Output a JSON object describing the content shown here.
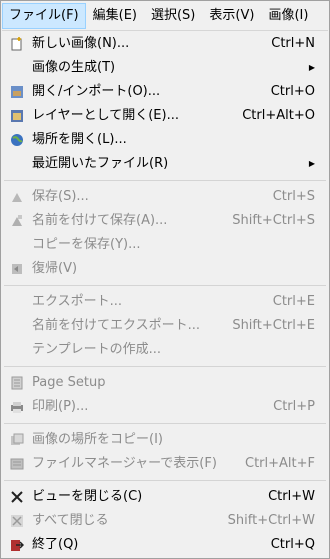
{
  "menubar": {
    "items": [
      {
        "label": "ファイル(F)"
      },
      {
        "label": "編集(E)"
      },
      {
        "label": "選択(S)"
      },
      {
        "label": "表示(V)"
      },
      {
        "label": "画像(I)"
      }
    ]
  },
  "menu": {
    "groups": [
      [
        {
          "label": "新しい画像(N)...",
          "shortcut": "Ctrl+N",
          "icon": "new-image-icon",
          "enabled": true
        },
        {
          "label": "画像の生成(T)",
          "submenu": true,
          "icon": "",
          "enabled": true
        },
        {
          "label": "開く/インポート(O)...",
          "shortcut": "Ctrl+O",
          "icon": "open-icon",
          "enabled": true
        },
        {
          "label": "レイヤーとして開く(E)...",
          "shortcut": "Ctrl+Alt+O",
          "icon": "open-as-layers-icon",
          "enabled": true
        },
        {
          "label": "場所を開く(L)...",
          "icon": "globe-icon",
          "enabled": true
        },
        {
          "label": "最近開いたファイル(R)",
          "submenu": true,
          "icon": "",
          "enabled": true
        }
      ],
      [
        {
          "label": "保存(S)...",
          "shortcut": "Ctrl+S",
          "icon": "save-icon",
          "enabled": false
        },
        {
          "label": "名前を付けて保存(A)...",
          "shortcut": "Shift+Ctrl+S",
          "icon": "save-as-icon",
          "enabled": false
        },
        {
          "label": "コピーを保存(Y)...",
          "icon": "",
          "enabled": false
        },
        {
          "label": "復帰(V)",
          "icon": "revert-icon",
          "enabled": false
        }
      ],
      [
        {
          "label": "エクスポート...",
          "shortcut": "Ctrl+E",
          "icon": "",
          "enabled": false
        },
        {
          "label": "名前を付けてエクスポート...",
          "shortcut": "Shift+Ctrl+E",
          "icon": "",
          "enabled": false
        },
        {
          "label": "テンプレートの作成...",
          "icon": "",
          "enabled": false
        }
      ],
      [
        {
          "label": "Page Setup",
          "icon": "page-setup-icon",
          "enabled": false
        },
        {
          "label": "印刷(P)...",
          "shortcut": "Ctrl+P",
          "icon": "print-icon",
          "enabled": false
        }
      ],
      [
        {
          "label": "画像の場所をコピー(I)",
          "icon": "copy-location-icon",
          "enabled": false
        },
        {
          "label": "ファイルマネージャーで表示(F)",
          "shortcut": "Ctrl+Alt+F",
          "icon": "file-manager-icon",
          "enabled": false
        }
      ],
      [
        {
          "label": "ビューを閉じる(C)",
          "shortcut": "Ctrl+W",
          "icon": "close-view-icon",
          "enabled": true
        },
        {
          "label": "すべて閉じる",
          "shortcut": "Shift+Ctrl+W",
          "icon": "close-all-icon",
          "enabled": false
        },
        {
          "label": "終了(Q)",
          "shortcut": "Ctrl+Q",
          "icon": "quit-icon",
          "enabled": true
        }
      ]
    ]
  }
}
